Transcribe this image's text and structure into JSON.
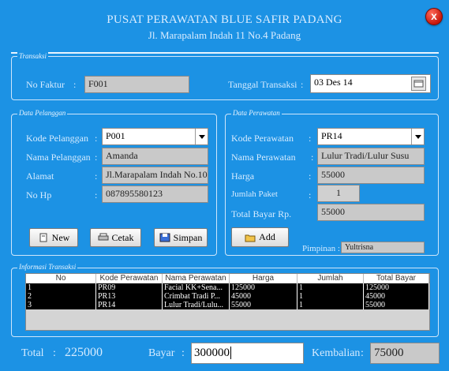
{
  "header": {
    "title": "PUSAT PERAWATAN BLUE SAFIR PADANG",
    "subtitle": "Jl. Marapalam Indah 11 No.4 Padang",
    "close_glyph": "x"
  },
  "transaksi": {
    "legend": "Transaksi",
    "no_faktur_label": "No Faktur",
    "no_faktur_value": "F001",
    "tanggal_label": "Tanggal Transaksi",
    "tanggal_value": "03 Des 14"
  },
  "pelanggan": {
    "legend": "Data Pelanggan",
    "kode_label": "Kode Pelanggan",
    "kode_value": "P001",
    "nama_label": "Nama Pelanggan",
    "nama_value": "Amanda",
    "alamat_label": "Alamat",
    "alamat_value": "Jl.Marapalam Indah No.10",
    "nohp_label": "No Hp",
    "nohp_value": "087895580123"
  },
  "perawatan": {
    "legend": "Data Perawatan",
    "kode_label": "Kode Perawatan",
    "kode_value": "PR14",
    "nama_label": "Nama Perawatan",
    "nama_value": "Lulur Tradi/Lulur Susu",
    "harga_label": "Harga",
    "harga_value": "55000",
    "jumlah_label": "Jumlah Paket",
    "jumlah_value": "1",
    "total_label": "Total Bayar  Rp.",
    "total_value": "55000",
    "pimpinan_label": "Pimpinan :",
    "pimpinan_value": "Yultrisna"
  },
  "buttons": {
    "new": "New",
    "cetak": "Cetak",
    "simpan": "Simpan",
    "add": "Add"
  },
  "informasi": {
    "legend": "Informasi Transaksi",
    "columns": [
      "No",
      "Kode Perawatan",
      "Nama Perawatan",
      "Harga",
      "Jumlah",
      "Total Bayar"
    ],
    "rows": [
      [
        "1",
        "PR09",
        "Facial KK+Sena...",
        "125000",
        "1",
        "125000"
      ],
      [
        "2",
        "PR13",
        "Crimbat Tradi P...",
        "45000",
        "1",
        "45000"
      ],
      [
        "3",
        "PR14",
        "Lulur Tradi/Lulu...",
        "55000",
        "1",
        "55000"
      ]
    ]
  },
  "footer": {
    "total_label": "Total",
    "total_value": "225000",
    "bayar_label": "Bayar",
    "bayar_value": "300000",
    "kembalian_label": "Kembalian",
    "kembalian_value": "75000"
  },
  "colors": {
    "background": "#1c92e4",
    "field_gray": "#c9c9c9",
    "close_red": "#d81e10"
  }
}
